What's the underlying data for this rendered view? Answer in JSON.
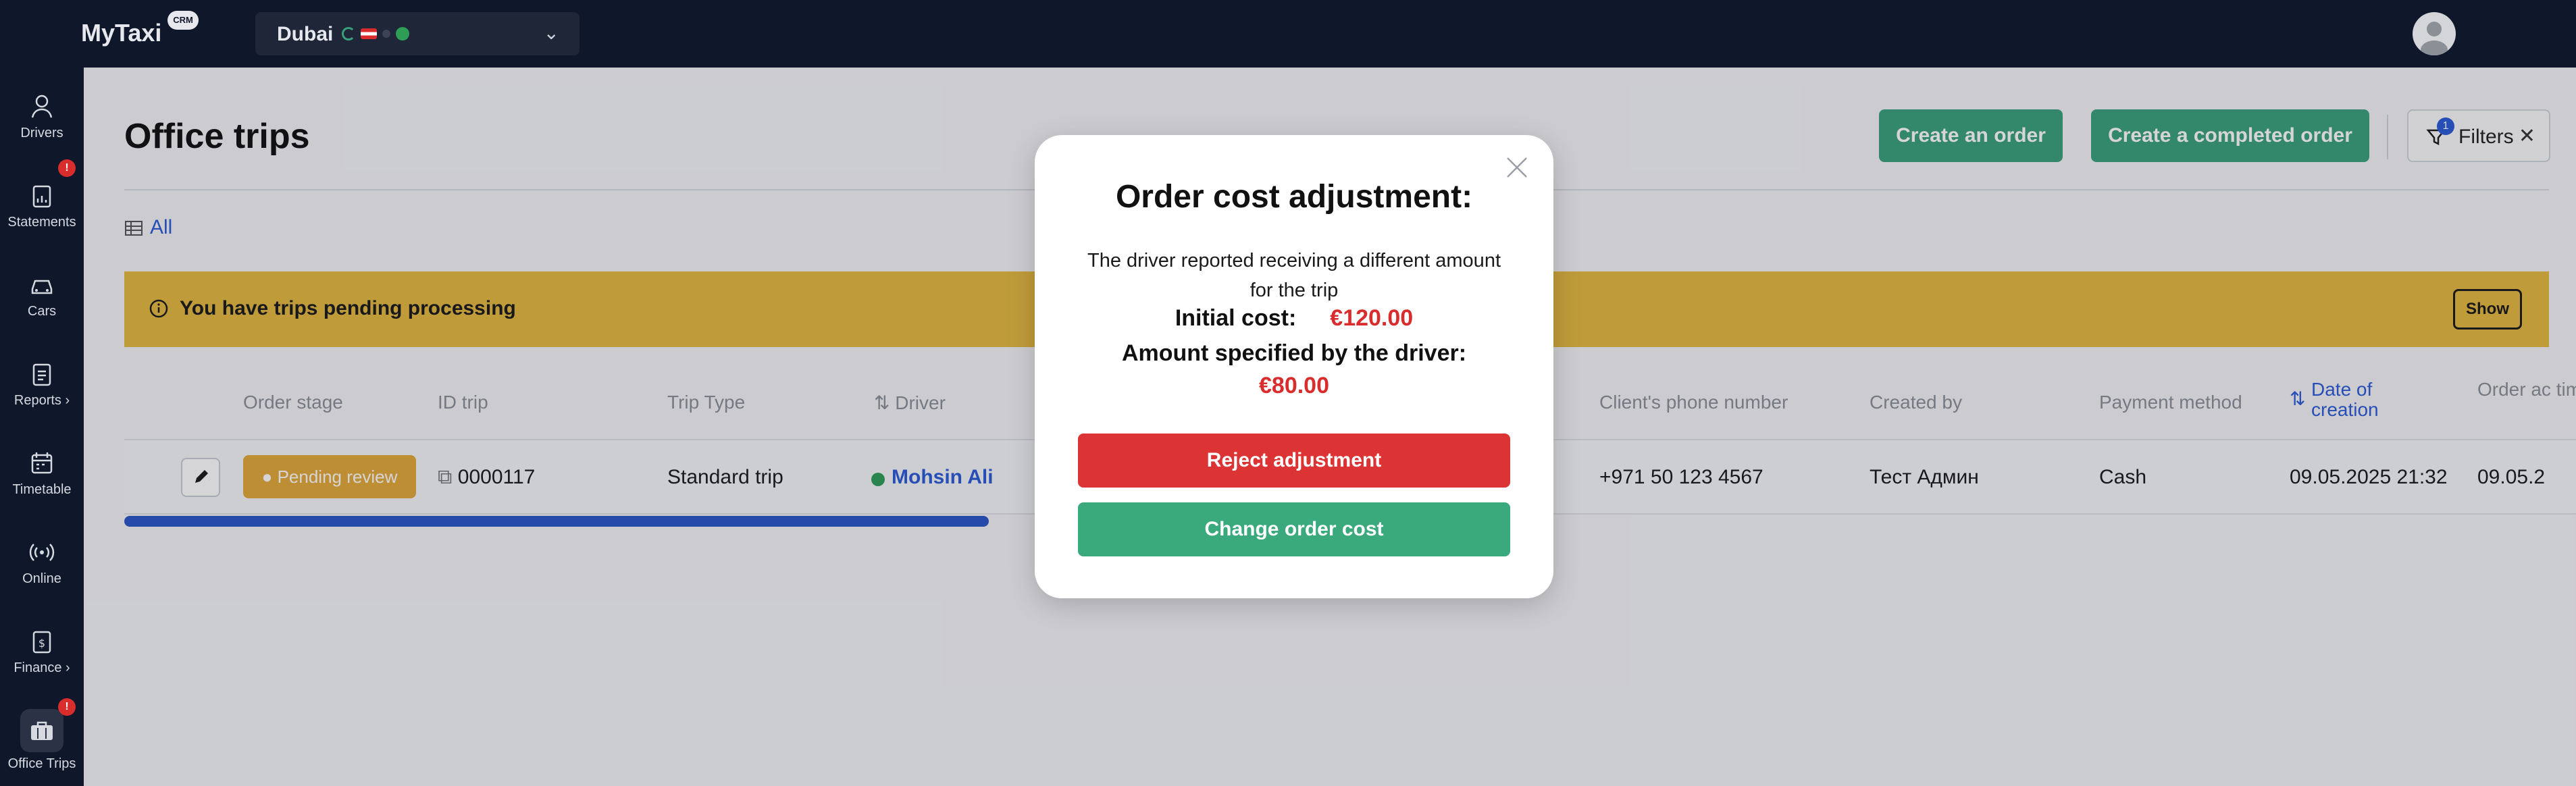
{
  "app": {
    "logo": "MyTaxi",
    "logo_badge": "CRM"
  },
  "city_selector": {
    "value": "Dubai"
  },
  "sidebar": {
    "items": [
      {
        "label": "Drivers",
        "icon": "user-icon"
      },
      {
        "label": "Statements",
        "icon": "clipboard-icon",
        "badge": "!"
      },
      {
        "label": "Cars",
        "icon": "car-icon"
      },
      {
        "label": "Reports ›",
        "icon": "report-icon"
      },
      {
        "label": "Timetable",
        "icon": "calendar-icon"
      },
      {
        "label": "Online",
        "icon": "broadcast-icon"
      },
      {
        "label": "Finance ›",
        "icon": "finance-icon"
      },
      {
        "label": "Office Trips",
        "icon": "briefcase-icon",
        "badge": "!",
        "active": true
      }
    ]
  },
  "page": {
    "title": "Office trips",
    "create_order_label": "Create an order",
    "create_completed_label": "Create a completed order",
    "filters_label": "Filters",
    "filters_count": "1",
    "all_tab_label": "All"
  },
  "banner": {
    "text": "You have trips pending processing",
    "show_label": "Show"
  },
  "table": {
    "headers": [
      "Order stage",
      "ID trip",
      "Trip Type",
      "Driver",
      "Client's phone number",
      "Created by",
      "Payment method",
      "Date of creation",
      "Order ac time"
    ],
    "row": {
      "stage": "Pending review",
      "id": "0000117",
      "type": "Standard trip",
      "driver": "Mohsin Ali",
      "phone": "+971 50 123 4567",
      "created_by": "Тест Админ",
      "payment": "Cash",
      "date_created": "09.05.2025 21:32",
      "order_time": "09.05.2"
    }
  },
  "modal": {
    "title": "Order cost adjustment:",
    "message": "The driver reported receiving a different amount for the trip",
    "initial_label": "Initial cost:",
    "initial_amount": "€120.00",
    "driver_label": "Amount specified by the driver:",
    "driver_amount": "€80.00",
    "reject_label": "Reject adjustment",
    "change_label": "Change order cost"
  },
  "colors": {
    "nav_bg": "#0f172a",
    "accent_blue": "#2a5bd7",
    "green": "#3aa07c",
    "red": "#dc3434",
    "banner_yellow": "#e4b93f"
  }
}
